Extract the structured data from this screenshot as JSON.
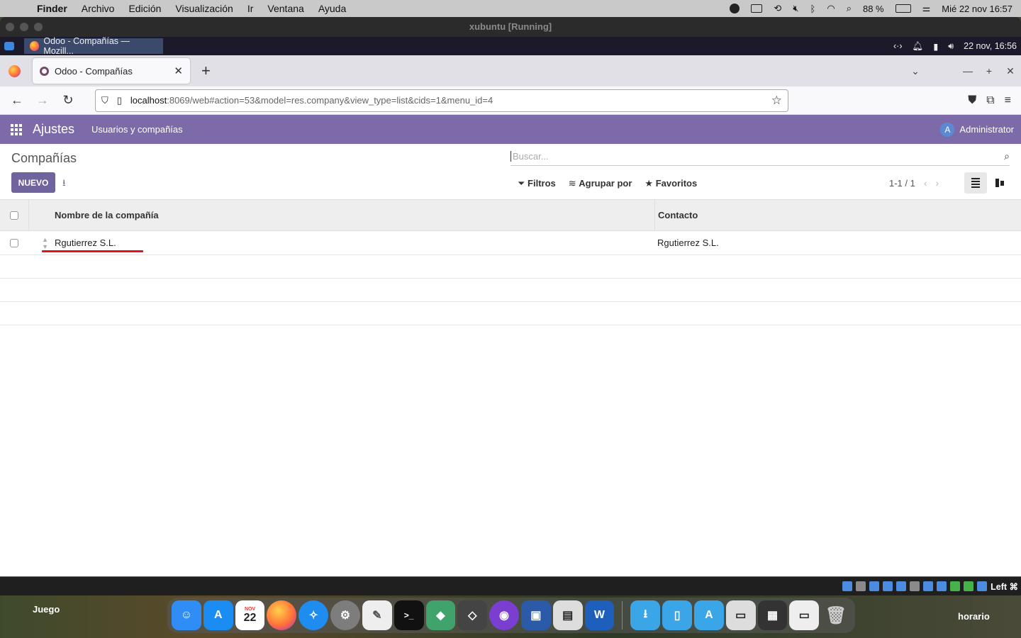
{
  "macos": {
    "menubar": [
      "Finder",
      "Archivo",
      "Edición",
      "Visualización",
      "Ir",
      "Ventana",
      "Ayuda"
    ],
    "battery": "88 %",
    "clock": "Mié 22 nov  16:57"
  },
  "vm": {
    "title": "xubuntu [Running]",
    "taskbar_item": "Odoo - Compañías — Mozill...",
    "clock": "22 nov, 16:56",
    "tray_right_label": "Left ⌘"
  },
  "browser": {
    "tab_title": "Odoo - Compañías",
    "url_host": "localhost",
    "url_rest": ":8069/web#action=53&model=res.company&view_type=list&cids=1&menu_id=4"
  },
  "odoo": {
    "app_name": "Ajustes",
    "menu": "Usuarios y compañías",
    "user": "Administrator",
    "user_initial": "A",
    "breadcrumb": "Compañías",
    "new_button": "NUEVO",
    "search_placeholder": "Buscar...",
    "filters": "Filtros",
    "group_by": "Agrupar por",
    "favorites": "Favoritos",
    "pager": "1-1 / 1",
    "columns": [
      "Nombre de la compañía",
      "Contacto"
    ],
    "rows": [
      {
        "name": "Rgutierrez S.L.",
        "contact": "Rgutierrez S.L."
      }
    ]
  },
  "desktop": {
    "left_label": "Juego",
    "right_label": "horario",
    "calendar_month": "NOV",
    "calendar_day": "22"
  },
  "colors": {
    "odoo_nav": "#7c6ba8",
    "primary_button": "#71639e",
    "annotation_underline": "#e0141e"
  }
}
